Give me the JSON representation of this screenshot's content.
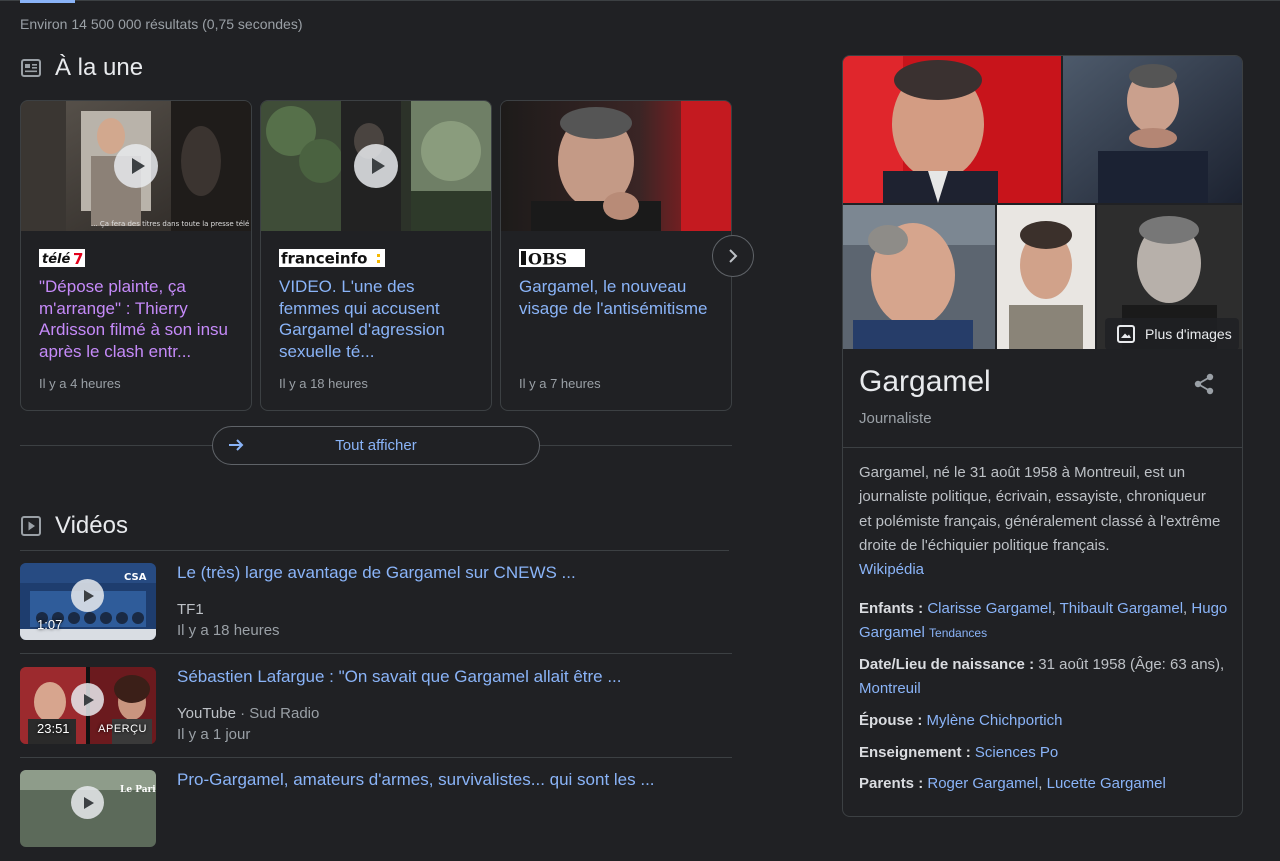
{
  "results_stats": "Environ 14 500 000 résultats (0,75 secondes)",
  "top_stories": {
    "title": "À la une",
    "icon": "newspaper-icon",
    "cards": [
      {
        "source_logo": "télé 7",
        "headline": "\"Dépose plainte, ça m'arrange\" : Thierry Ardisson filmé à son insu après le clash entr...",
        "time": "Il y a 4 heures",
        "visited": true,
        "has_video": true
      },
      {
        "source_logo": "franceinfo:",
        "headline": "VIDEO. L'une des femmes qui accusent Gargamel d'agression sexuelle té...",
        "time": "Il y a 18 heures",
        "visited": false,
        "has_video": true
      },
      {
        "source_logo": "L'OBS",
        "headline": "Gargamel, le nouveau visage de l'antisémitisme",
        "time": "Il y a 7 heures",
        "visited": false,
        "has_video": false
      }
    ],
    "show_all_label": "Tout afficher"
  },
  "videos": {
    "title": "Vidéos",
    "icon": "video-icon",
    "items": [
      {
        "title": "Le (très) large avantage de Gargamel sur CNEWS ...",
        "source": "TF1",
        "channel": "",
        "time": "Il y a 18 heures",
        "duration": "1:07",
        "badge": ""
      },
      {
        "title": "Sébastien Lafargue : \"On savait que Gargamel allait être ...",
        "source": "YouTube",
        "channel": "Sud Radio",
        "time": "Il y a 1 jour",
        "duration": "23:51",
        "badge": "APERÇU"
      },
      {
        "title": "Pro-Gargamel, amateurs d'armes, survivalistes... qui sont les ...",
        "source": "",
        "channel": "",
        "time": "",
        "duration": "",
        "badge": ""
      }
    ]
  },
  "knowledge_panel": {
    "more_images_label": "Plus d'images",
    "name": "Gargamel",
    "subtitle": "Journaliste",
    "description": "Gargamel, né le 31 août 1958 à Montreuil, est un journaliste politique, écrivain, essayiste, chroniqueur et polémiste français, généralement classé à l'extrême droite de l'échiquier politique français.",
    "description_source": "Wikipédia",
    "facts": {
      "children_label": "Enfants :",
      "children": [
        "Clarisse Gargamel",
        "Thibault Gargamel",
        "Hugo Gargamel"
      ],
      "trend_label": "Tendances",
      "birth_label": "Date/Lieu de naissance :",
      "birth_value": "31 août 1958 (Âge: 63 ans),",
      "birth_place": "Montreuil",
      "spouse_label": "Épouse :",
      "spouse": "Mylène Chichportich",
      "education_label": "Enseignement :",
      "education": "Sciences Po",
      "parents_label": "Parents :",
      "parents": [
        "Roger Gargamel",
        "Lucette Gargamel"
      ]
    }
  },
  "colors": {
    "background": "#202124",
    "link": "#8ab4f8",
    "visited": "#c58af9",
    "text": "#bdc1c6"
  }
}
